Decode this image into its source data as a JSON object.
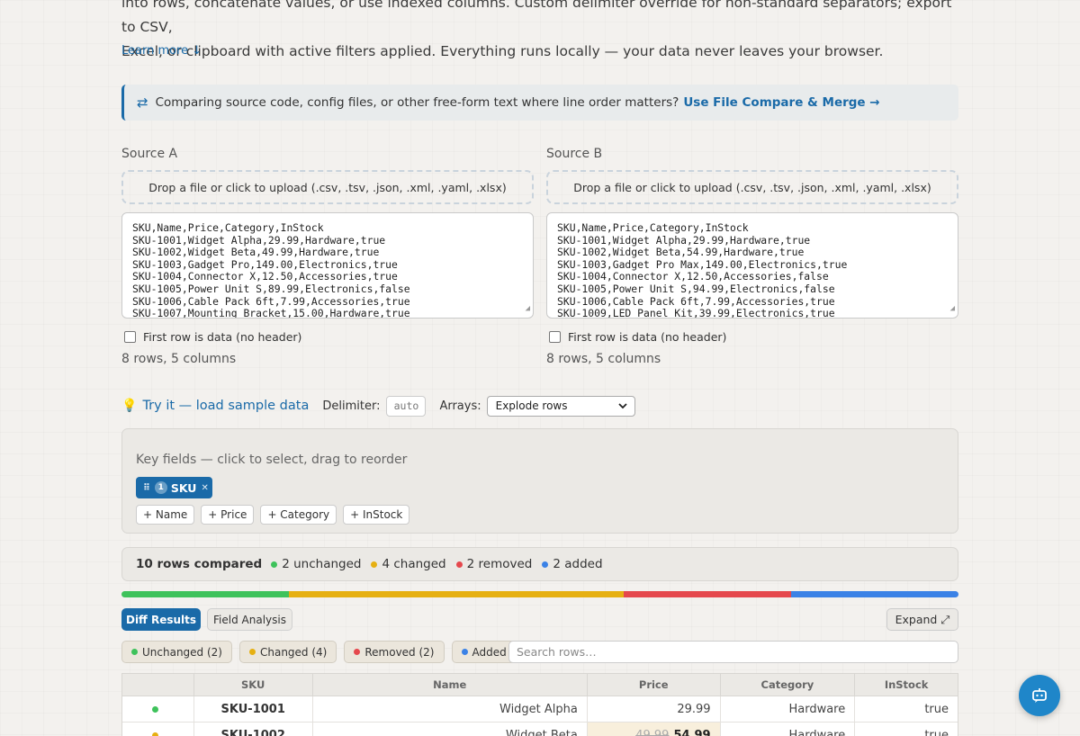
{
  "intro": {
    "line1": "into rows, concatenate values, or use indexed columns. Custom delimiter override for non-standard separators; export to CSV,",
    "line2": "Excel, or clipboard with active filters applied. Everything runs locally — your data never leaves your browser.",
    "learn_more": "Learn more ↓"
  },
  "callout": {
    "icon": "⇄",
    "text": "Comparing source code, config files, or other free-form text where line order matters?",
    "link": "Use File Compare & Merge →"
  },
  "source_a": {
    "label": "Source A",
    "drop_text": "Drop a file or click to upload (.csv, .tsv, .json, .xml, .yaml, .xlsx)",
    "content": "SKU,Name,Price,Category,InStock\nSKU-1001,Widget Alpha,29.99,Hardware,true\nSKU-1002,Widget Beta,49.99,Hardware,true\nSKU-1003,Gadget Pro,149.00,Electronics,true\nSKU-1004,Connector X,12.50,Accessories,true\nSKU-1005,Power Unit S,89.99,Electronics,false\nSKU-1006,Cable Pack 6ft,7.99,Accessories,true\nSKU-1007,Mounting Bracket,15.00,Hardware,true",
    "checkbox_label": "First row is data (no header)",
    "row_count": "8 rows, 5 columns"
  },
  "source_b": {
    "label": "Source B",
    "drop_text": "Drop a file or click to upload (.csv, .tsv, .json, .xml, .yaml, .xlsx)",
    "content": "SKU,Name,Price,Category,InStock\nSKU-1001,Widget Alpha,29.99,Hardware,true\nSKU-1002,Widget Beta,54.99,Hardware,true\nSKU-1003,Gadget Pro Max,149.00,Electronics,true\nSKU-1004,Connector X,12.50,Accessories,false\nSKU-1005,Power Unit S,94.99,Electronics,false\nSKU-1006,Cable Pack 6ft,7.99,Accessories,true\nSKU-1009,LED Panel Kit,39.99,Electronics,true",
    "checkbox_label": "First row is data (no header)",
    "row_count": "8 rows, 5 columns"
  },
  "toolbar": {
    "try_label": "Try it — load sample data",
    "delimiter_label": "Delimiter:",
    "delimiter_placeholder": "auto",
    "arrays_label": "Arrays:",
    "arrays_value": "Explode rows"
  },
  "keys": {
    "title": "Key fields — click to select, drag to reorder",
    "selected": [
      {
        "order": "1",
        "name": "SKU"
      }
    ],
    "available": [
      "+ Name",
      "+ Price",
      "+ Category",
      "+ InStock"
    ]
  },
  "summary": {
    "total": "10 rows compared",
    "unchanged": "2 unchanged",
    "changed": "4 changed",
    "removed": "2 removed",
    "added": "2 added",
    "counts": {
      "unchanged": 2,
      "changed": 4,
      "removed": 2,
      "added": 2
    }
  },
  "colors": {
    "unchanged": "#3ec25b",
    "changed": "#e6b012",
    "removed": "#e5484d",
    "added": "#3b82e6",
    "accent": "#1a6aa8"
  },
  "tabs": {
    "diff": "Diff Results",
    "field": "Field Analysis",
    "expand": "Expand ⤢"
  },
  "filters": {
    "unchanged": "Unchanged (2)",
    "changed": "Changed (4)",
    "removed": "Removed (2)",
    "added": "Added (2)",
    "search_placeholder": "Search rows…"
  },
  "table": {
    "headers": [
      "",
      "SKU",
      "Name",
      "Price",
      "Category",
      "InStock"
    ],
    "rows": [
      {
        "status": "unchanged",
        "sku": "SKU-1001",
        "name": "Widget Alpha",
        "price": "29.99",
        "category": "Hardware",
        "instock": "true"
      },
      {
        "status": "changed",
        "sku": "SKU-1002",
        "name": "Widget Beta",
        "price_old": "49.99",
        "price_new": "54.99",
        "category": "Hardware",
        "instock": "true"
      }
    ]
  }
}
